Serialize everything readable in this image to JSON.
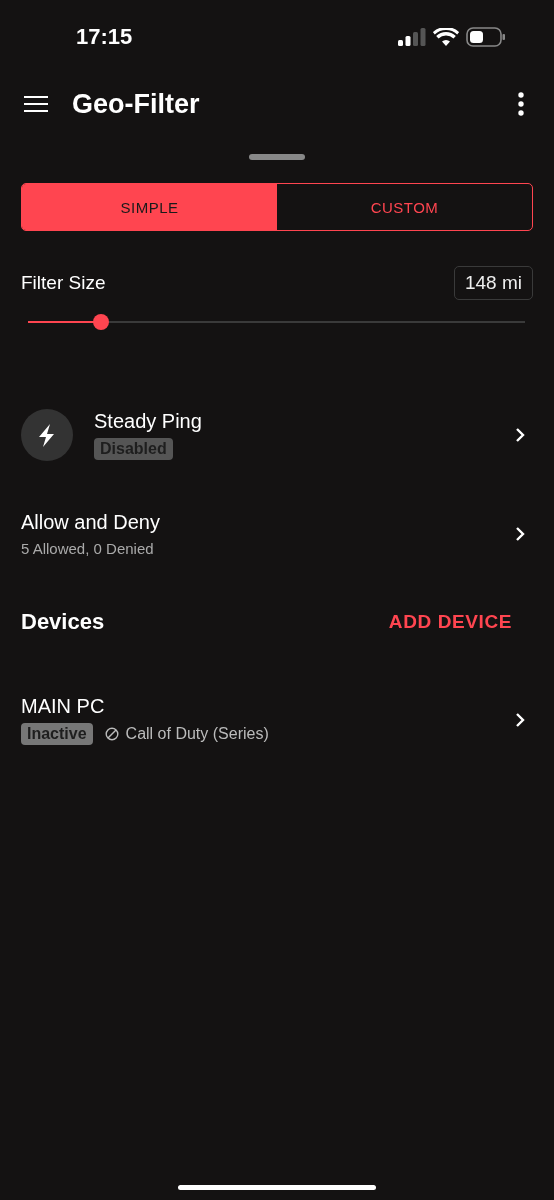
{
  "status_bar": {
    "time": "17:15"
  },
  "app_bar": {
    "title": "Geo-Filter"
  },
  "segments": [
    {
      "label": "SIMPLE",
      "selected": true
    },
    {
      "label": "CUSTOM",
      "selected": false
    }
  ],
  "filter_size": {
    "label": "Filter Size",
    "value": "148 mi",
    "level": 0.147
  },
  "rows": [
    {
      "kind": "feature",
      "title": "Steady Ping",
      "badge": "Disabled"
    },
    {
      "kind": "plain",
      "title": "Allow and Deny",
      "subtitle": "5 Allowed, 0 Denied"
    }
  ],
  "devices": {
    "heading": "Devices",
    "action": "ADD DEVICE",
    "items": [
      {
        "name": "MAIN PC",
        "badge": "Inactive",
        "game": "Call of Duty (Series)"
      }
    ]
  }
}
